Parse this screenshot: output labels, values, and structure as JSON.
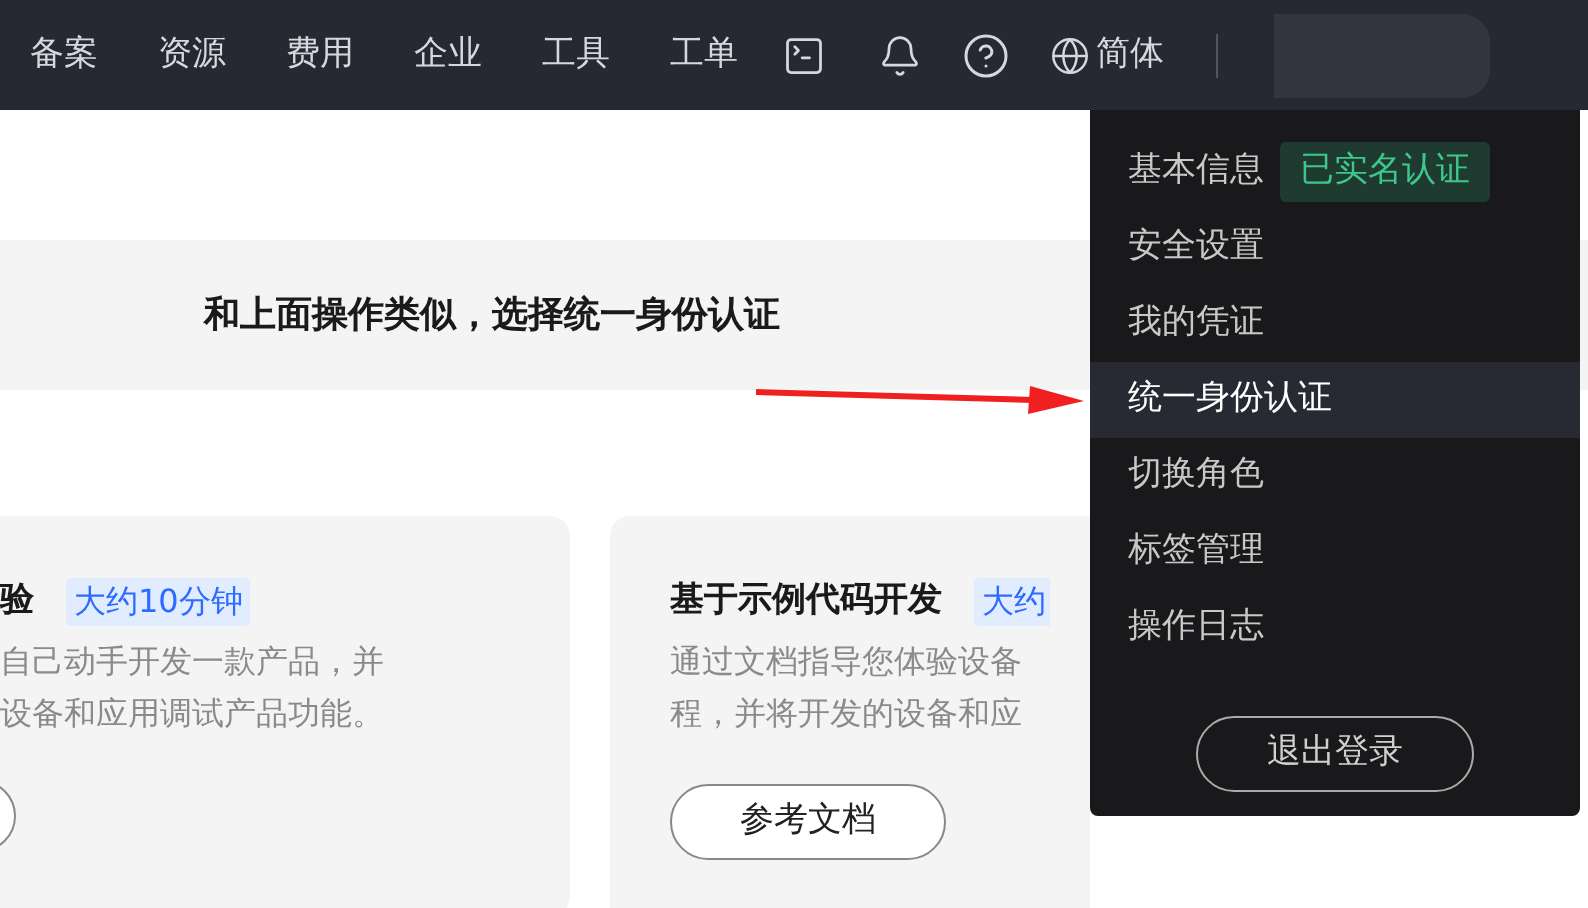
{
  "topbar": {
    "nav": [
      "备案",
      "资源",
      "费用",
      "企业",
      "工具",
      "工单"
    ],
    "language": "简体"
  },
  "annotation": {
    "caption": "和上面操作类似，选择统一身份认证"
  },
  "cards": [
    {
      "title": "验",
      "badge": "大约10分钟",
      "description": [
        "自己动手开发一款产品，并",
        "设备和应用调试产品功能。"
      ]
    },
    {
      "title": "基于示例代码开发",
      "badge": "大约",
      "description": [
        "通过文档指导您体验设备",
        "程，并将开发的设备和应"
      ],
      "button": "参考文档"
    }
  ],
  "account_menu": {
    "items": [
      {
        "label": "基本信息",
        "badge": "已实名认证",
        "selected": false
      },
      {
        "label": "安全设置",
        "selected": false
      },
      {
        "label": "我的凭证",
        "selected": false
      },
      {
        "label": "统一身份认证",
        "selected": true
      },
      {
        "label": "切换角色",
        "selected": false
      },
      {
        "label": "标签管理",
        "selected": false
      },
      {
        "label": "操作日志",
        "selected": false
      }
    ],
    "logout": "退出登录"
  }
}
